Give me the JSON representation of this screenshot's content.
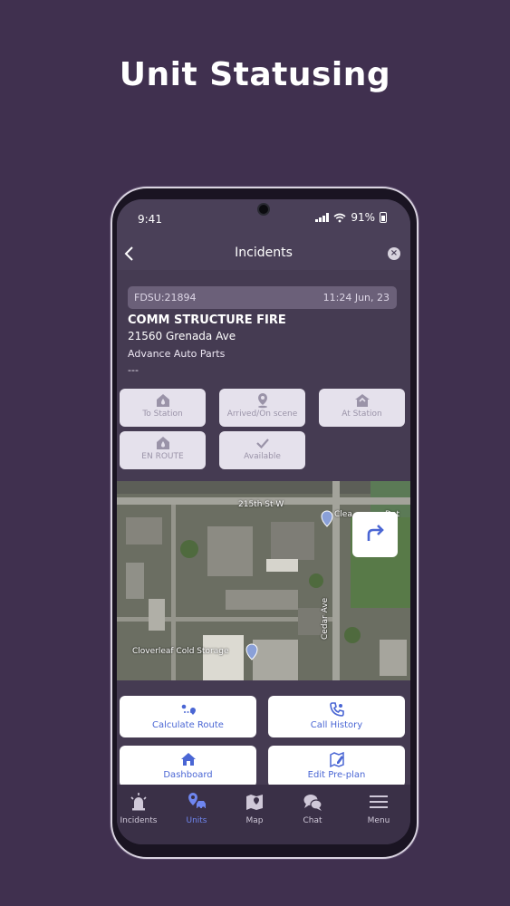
{
  "headline": "Unit Statusing",
  "status_bar": {
    "time": "9:41",
    "battery": "91%"
  },
  "header": {
    "title": "Incidents",
    "back_icon": "chevron-left-icon",
    "close_icon": "close-icon"
  },
  "incident": {
    "id": "FDSU:21894",
    "time": "11:24 Jun, 23",
    "type": "COMM STRUCTURE FIRE",
    "address": "21560 Grenada Ave",
    "place": "Advance Auto Parts",
    "extra": "---"
  },
  "status_buttons": [
    {
      "label": "To Station",
      "icon": "house-drop-icon"
    },
    {
      "label": "Arrived/On scene",
      "icon": "map-pin-icon"
    },
    {
      "label": "At Station",
      "icon": "house-check-icon"
    },
    {
      "label": "EN ROUTE",
      "icon": "house-drop-icon"
    },
    {
      "label": "Available",
      "icon": "check-icon"
    }
  ],
  "map": {
    "labels": [
      "215th St W",
      "Clea",
      "Det",
      "Cloverleaf Cold Storage",
      "Cedar Ave"
    ],
    "directions_icon": "turn-right-arrow-icon"
  },
  "actions": [
    {
      "label": "Calculate Route",
      "icon": "route-icon"
    },
    {
      "label": "Call History",
      "icon": "phone-icon"
    },
    {
      "label": "Dashboard",
      "icon": "home-icon"
    },
    {
      "label": "Edit Pre-plan",
      "icon": "edit-map-icon"
    }
  ],
  "tabs": [
    {
      "label": "Incidents",
      "icon": "alarm-icon",
      "active": false
    },
    {
      "label": "Units",
      "icon": "units-pin-icon",
      "active": true
    },
    {
      "label": "Map",
      "icon": "map-icon",
      "active": false
    },
    {
      "label": "Chat",
      "icon": "chat-icon",
      "active": false
    },
    {
      "label": "Menu",
      "icon": "hamburger-menu-icon",
      "active": false
    }
  ],
  "colors": {
    "background": "#40304f",
    "screen": "#453b52",
    "accent": "#4a66d4",
    "tab_active": "#6f86f0"
  }
}
